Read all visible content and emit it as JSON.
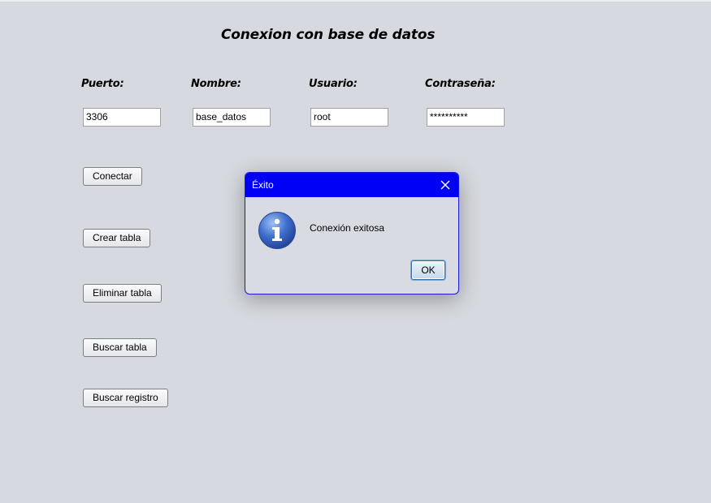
{
  "window": {
    "title": "Conexion con base de datos"
  },
  "fields": [
    {
      "label": "Puerto:",
      "value": "3306"
    },
    {
      "label": "Nombre:",
      "value": "base_datos"
    },
    {
      "label": "Usuario:",
      "value": "root"
    },
    {
      "label": "Contraseña:",
      "value": "**********"
    }
  ],
  "buttons": {
    "connect": "Conectar",
    "create_table": "Crear tabla",
    "delete_table": "Eliminar tabla",
    "search_table": "Buscar tabla",
    "search_record": "Buscar registro"
  },
  "dialog": {
    "title": "Éxito",
    "message": "Conexión exitosa",
    "ok_label": "OK",
    "icon": "info-icon",
    "close_icon": "close-icon"
  },
  "colors": {
    "background": "#d6d9df",
    "dialog_titlebar": "#0000f5",
    "dialog_border": "#1a1ad0",
    "info_icon": "#3a69c4"
  }
}
